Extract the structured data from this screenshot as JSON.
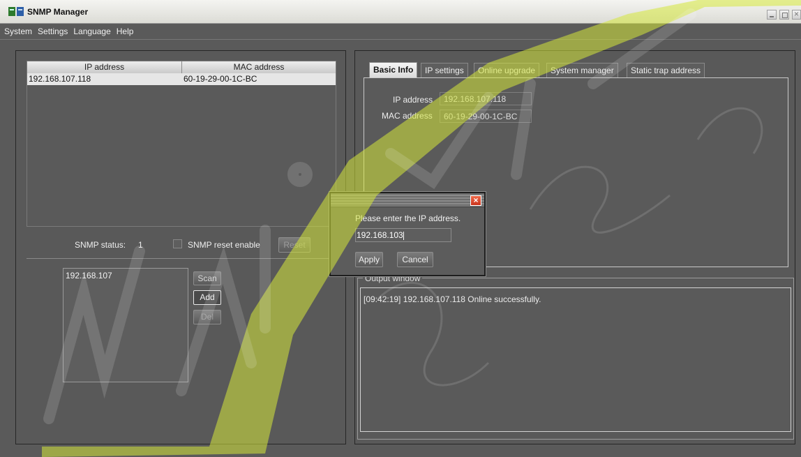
{
  "window": {
    "title": "SNMP Manager"
  },
  "menu": [
    "System",
    "Settings",
    "Language",
    "Help"
  ],
  "device_table": {
    "columns": [
      "IP address",
      "MAC address"
    ],
    "rows": [
      {
        "ip": "192.168.107.118",
        "mac": "60-19-29-00-1C-BC"
      }
    ]
  },
  "status": {
    "label": "SNMP status:",
    "value": "1",
    "reset_enable_label": "SNMP reset enable",
    "reset_button": "Reset"
  },
  "ip_list": {
    "items": [
      "192.168.107"
    ]
  },
  "buttons": {
    "scan": "Scan",
    "add": "Add",
    "del": "Del"
  },
  "tabs": [
    "Basic Info",
    "IP settings",
    "Online upgrade",
    "System manager",
    "Static trap address"
  ],
  "basic_info": {
    "ip_label": "IP address",
    "ip_value": "192.168.107.118",
    "mac_label": "MAC address",
    "mac_value": "60-19-29-00-1C-BC"
  },
  "output": {
    "title": "Output window",
    "lines": [
      "[09:42:19]  192.168.107.118 Online successfully."
    ]
  },
  "dialog": {
    "prompt": "Please enter the IP address.",
    "input_value": "192.168.103",
    "apply": "Apply",
    "cancel": "Cancel"
  },
  "colors": {
    "background": "#5a5a5a",
    "accent_yellow": "#d8e83a",
    "close_red": "#d9472b"
  }
}
